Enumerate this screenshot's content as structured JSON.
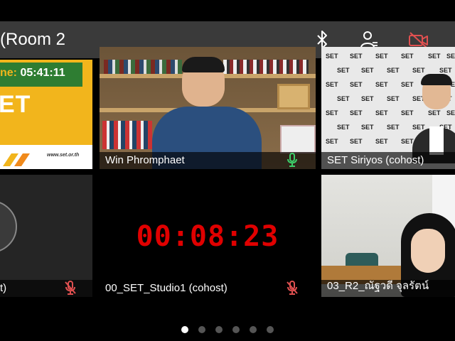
{
  "meeting": {
    "title": "(Room 2"
  },
  "top_icons": [
    "bluetooth-icon",
    "participants-icon",
    "camera-off-icon"
  ],
  "slide": {
    "time_label": "ne:",
    "time_value": "05:41:11",
    "big_text": "ET",
    "url": "www.set.or.th"
  },
  "tiles": [
    {
      "name": "",
      "mic": "off"
    },
    {
      "name": "Win Phromphaet",
      "mic": "on",
      "active": true
    },
    {
      "name": "SET Siriyos (cohost)",
      "mic": "none"
    },
    {
      "name": "t)",
      "mic": "off"
    },
    {
      "name": "00_SET_Studio1 (cohost)",
      "mic": "off",
      "timer": "00:08:23"
    },
    {
      "name": "03_R2_ณัฐวดี จุลรัตน์",
      "mic": "none"
    }
  ],
  "logo_text": "SET",
  "pagination": {
    "count": 6,
    "current": 1
  },
  "colors": {
    "topbar": "#3a3a3a",
    "slide_yellow": "#f2b51c",
    "slide_green": "#2e7d32",
    "timer_red": "#e00000",
    "mic_on": "#3ccf6a",
    "mic_off": "#e05050",
    "active_border": "#f0c800"
  }
}
